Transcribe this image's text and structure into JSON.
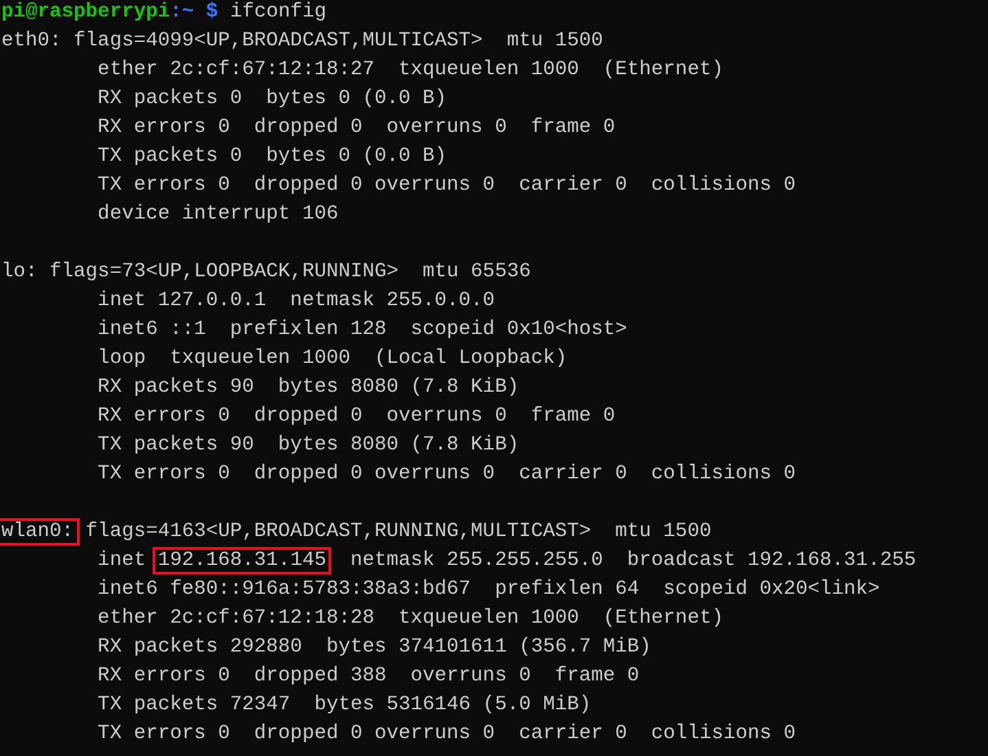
{
  "terminal": {
    "prompt": {
      "user_host": "pi@raspberrypi",
      "separator": ":",
      "path": "~",
      "symbol": "$",
      "command": "ifconfig"
    },
    "blocks": [
      {
        "lines": [
          [
            {
              "text": "eth0: flags=4099<UP,BROADCAST,MULTICAST>  mtu 1500",
              "highlighted": false
            }
          ],
          [
            {
              "text": "        ether 2c:cf:67:12:18:27  txqueuelen 1000  (Ethernet)",
              "highlighted": false
            }
          ],
          [
            {
              "text": "        RX packets 0  bytes 0 (0.0 B)",
              "highlighted": false
            }
          ],
          [
            {
              "text": "        RX errors 0  dropped 0  overruns 0  frame 0",
              "highlighted": false
            }
          ],
          [
            {
              "text": "        TX packets 0  bytes 0 (0.0 B)",
              "highlighted": false
            }
          ],
          [
            {
              "text": "        TX errors 0  dropped 0 overruns 0  carrier 0  collisions 0",
              "highlighted": false
            }
          ],
          [
            {
              "text": "        device interrupt 106",
              "highlighted": false
            }
          ]
        ]
      },
      {
        "lines": [
          [
            {
              "text": "lo: flags=73<UP,LOOPBACK,RUNNING>  mtu 65536",
              "highlighted": false
            }
          ],
          [
            {
              "text": "        inet 127.0.0.1  netmask 255.0.0.0",
              "highlighted": false
            }
          ],
          [
            {
              "text": "        inet6 ::1  prefixlen 128  scopeid 0x10<host>",
              "highlighted": false
            }
          ],
          [
            {
              "text": "        loop  txqueuelen 1000  (Local Loopback)",
              "highlighted": false
            }
          ],
          [
            {
              "text": "        RX packets 90  bytes 8080 (7.8 KiB)",
              "highlighted": false
            }
          ],
          [
            {
              "text": "        RX errors 0  dropped 0  overruns 0  frame 0",
              "highlighted": false
            }
          ],
          [
            {
              "text": "        TX packets 90  bytes 8080 (7.8 KiB)",
              "highlighted": false
            }
          ],
          [
            {
              "text": "        TX errors 0  dropped 0 overruns 0  carrier 0  collisions 0",
              "highlighted": false
            }
          ]
        ]
      },
      {
        "lines": [
          [
            {
              "text": "wlan0:",
              "highlighted": true
            },
            {
              "text": " flags=4163<UP,BROADCAST,RUNNING,MULTICAST>  mtu 1500",
              "highlighted": false
            }
          ],
          [
            {
              "text": "        inet ",
              "highlighted": false
            },
            {
              "text": "192.168.31.145",
              "highlighted": true
            },
            {
              "text": "  netmask 255.255.255.0  broadcast 192.168.31.255",
              "highlighted": false
            }
          ],
          [
            {
              "text": "        inet6 fe80::916a:5783:38a3:bd67  prefixlen 64  scopeid 0x20<link>",
              "highlighted": false
            }
          ],
          [
            {
              "text": "        ether 2c:cf:67:12:18:28  txqueuelen 1000  (Ethernet)",
              "highlighted": false
            }
          ],
          [
            {
              "text": "        RX packets 292880  bytes 374101611 (356.7 MiB)",
              "highlighted": false
            }
          ],
          [
            {
              "text": "        RX errors 0  dropped 388  overruns 0  frame 0",
              "highlighted": false
            }
          ],
          [
            {
              "text": "        TX packets 72347  bytes 5316146 (5.0 MiB)",
              "highlighted": false
            }
          ],
          [
            {
              "text": "        TX errors 0  dropped 0 overruns 0  carrier 0  collisions 0",
              "highlighted": false
            }
          ]
        ]
      }
    ]
  }
}
